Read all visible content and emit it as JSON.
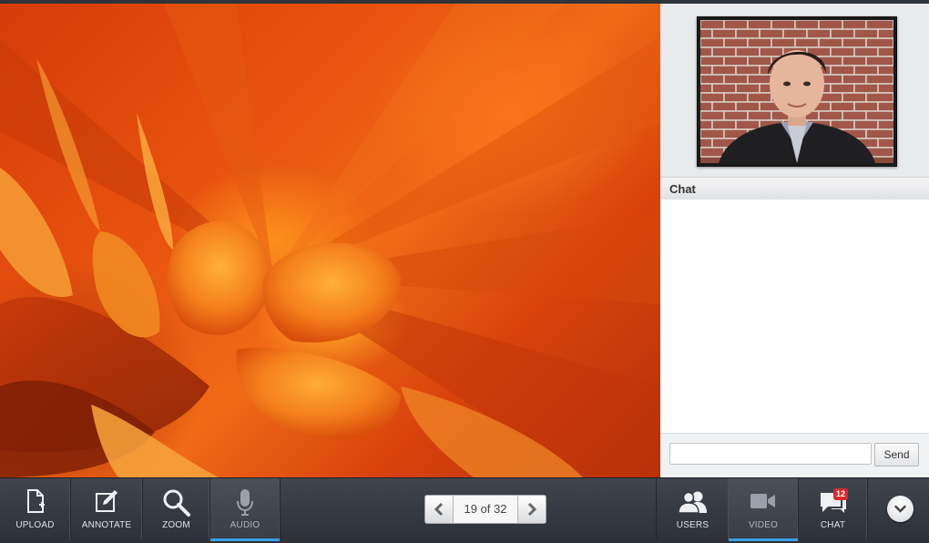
{
  "slide": {
    "image": "orange-flower-macro-photo"
  },
  "video": {
    "webcam": "presenter-webcam-feed"
  },
  "chat": {
    "title": "Chat",
    "input_value": "",
    "input_placeholder": "",
    "send_label": "Send"
  },
  "toolbar": {
    "left_tools": [
      {
        "label": "UPLOAD",
        "icon": "upload-icon"
      },
      {
        "label": "ANNOTATE",
        "icon": "annotate-icon"
      },
      {
        "label": "ZOOM",
        "icon": "zoom-icon"
      },
      {
        "label": "AUDIO",
        "icon": "microphone-icon",
        "active": true
      }
    ],
    "pager": {
      "text": "19 of 32",
      "current": 19,
      "total": 32
    },
    "right_tools": [
      {
        "label": "USERS",
        "icon": "users-icon"
      },
      {
        "label": "VIDEO",
        "icon": "video-camera-icon",
        "active": true
      },
      {
        "label": "CHAT",
        "icon": "chat-icon",
        "badge": "12"
      }
    ],
    "more_icon": "chevron-down-icon"
  },
  "colors": {
    "toolbar": "#353941",
    "active_indicator": "#3aa0e6",
    "badge": "#d52b2b"
  }
}
